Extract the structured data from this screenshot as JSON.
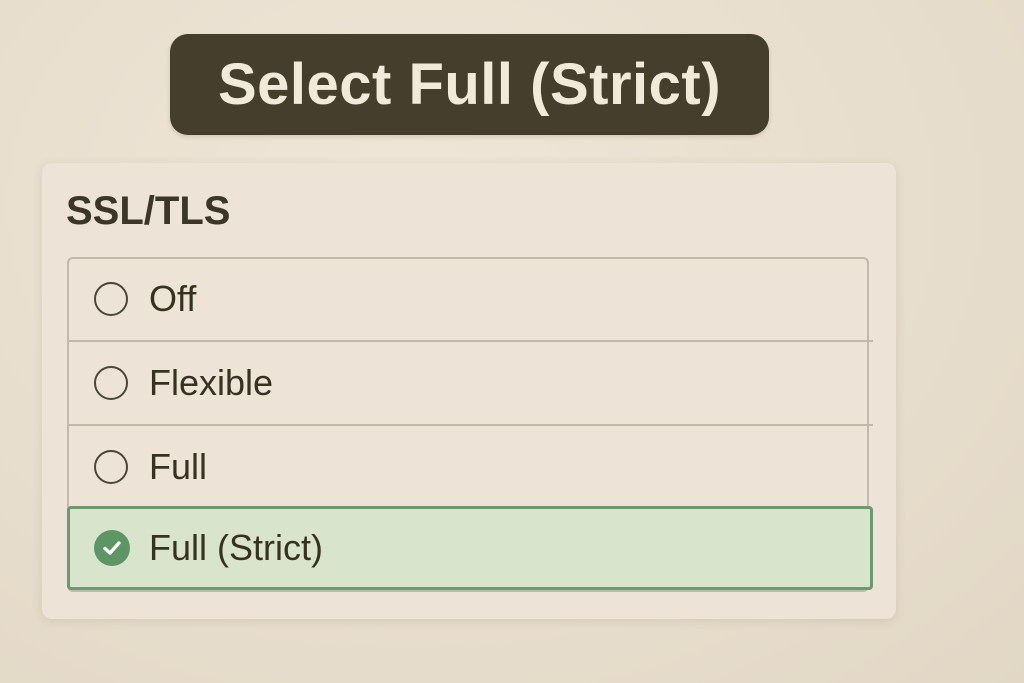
{
  "instruction_banner": {
    "text": "Select Full (Strict)"
  },
  "ssl_panel": {
    "title": "SSL/TLS",
    "options": [
      {
        "label": "Off",
        "selected": false
      },
      {
        "label": "Flexible",
        "selected": false
      },
      {
        "label": "Full",
        "selected": false
      },
      {
        "label": "Full (Strict)",
        "selected": true
      }
    ],
    "selected_icon": "check-circle-icon",
    "unselected_icon": "radio-circle-icon"
  },
  "colors": {
    "background": "#e8dfd0",
    "banner_bg": "#463e2c",
    "banner_text": "#f1eadb",
    "panel_bg": "#ede4d7",
    "selected_bg": "#d9e4cc",
    "selected_border": "#6a9a6e",
    "check_fill": "#5d9564"
  }
}
